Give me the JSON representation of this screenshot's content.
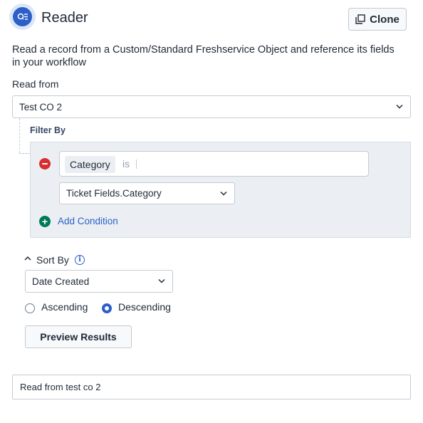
{
  "header": {
    "title": "Reader",
    "clone_label": "Clone"
  },
  "description": "Read a record from a Custom/Standard Freshservice Object and reference its fields in your workflow",
  "read_from": {
    "label": "Read from",
    "value": "Test CO 2"
  },
  "filter": {
    "label": "Filter By",
    "condition": {
      "field": "Category",
      "operator": "is",
      "value_select": "Ticket Fields.Category"
    },
    "add_condition_label": "Add Condition"
  },
  "sort": {
    "label": "Sort By",
    "value": "Date Created",
    "options": [
      {
        "label": "Ascending",
        "checked": false
      },
      {
        "label": "Descending",
        "checked": true
      }
    ]
  },
  "preview_label": "Preview Results",
  "node_name": "Read from test co 2",
  "colors": {
    "accent": "#2c5fc7",
    "danger": "#d72d30",
    "success": "#00795b",
    "panel": "#ebeff3"
  }
}
